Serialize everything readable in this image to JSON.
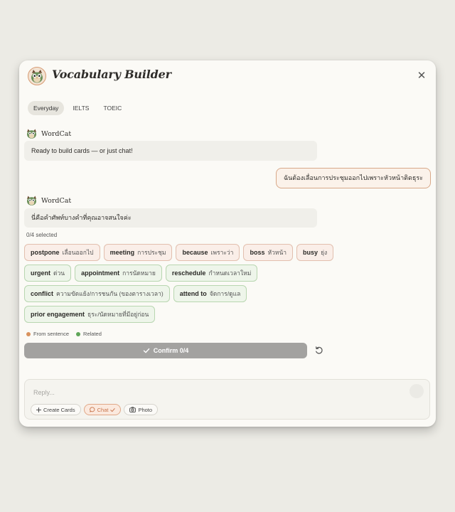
{
  "app": {
    "title": "Vocabulary Builder"
  },
  "tabs": [
    {
      "label": "Everyday",
      "active": true
    },
    {
      "label": "IELTS",
      "active": false
    },
    {
      "label": "TOEIC",
      "active": false
    }
  ],
  "messages": {
    "bot_name": "WordCat",
    "bot_first": "Ready to build cards — or just chat!",
    "user_message": "ฉันต้องเลื่อนการประชุมออกไปเพราะหัวหน้าติดธุระ",
    "bot_second": "นี่คือคำศัพท์บางคำที่คุณอาจสนใจค่ะ"
  },
  "selection": {
    "count_label": "0/4 selected"
  },
  "chips": [
    [
      {
        "word": "postpone",
        "translation": "เลื่อนออกไป",
        "kind": "sentence"
      },
      {
        "word": "meeting",
        "translation": "การประชุม",
        "kind": "sentence"
      },
      {
        "word": "because",
        "translation": "เพราะว่า",
        "kind": "sentence"
      },
      {
        "word": "boss",
        "translation": "หัวหน้า",
        "kind": "sentence"
      },
      {
        "word": "busy",
        "translation": "ยุ่ง",
        "kind": "sentence"
      }
    ],
    [
      {
        "word": "urgent",
        "translation": "ด่วน",
        "kind": "related"
      },
      {
        "word": "appointment",
        "translation": "การนัดหมาย",
        "kind": "related"
      },
      {
        "word": "reschedule",
        "translation": "กำหนดเวลาใหม่",
        "kind": "related"
      }
    ],
    [
      {
        "word": "conflict",
        "translation": "ความขัดแย้ง/การชนกัน (ของตารางเวลา)",
        "kind": "related"
      },
      {
        "word": "attend to",
        "translation": "จัดการ/ดูแล",
        "kind": "related"
      }
    ],
    [
      {
        "word": "prior engagement",
        "translation": "ธุระ/นัดหมายที่มีอยู่ก่อน",
        "kind": "related"
      }
    ]
  ],
  "legend": {
    "sentence_label": "From sentence",
    "related_label": "Related",
    "sentence_color": "#d9925e",
    "related_color": "#5fa558"
  },
  "confirm": {
    "label": "Confirm 0/4"
  },
  "composer": {
    "placeholder": "Reply...",
    "create_cards_label": "Create Cards",
    "chat_label": "Chat",
    "photo_label": "Photo"
  },
  "icons": {
    "logo": "owl-cat-logo",
    "close": "close-icon",
    "reset": "reset-icon",
    "check": "check-icon"
  }
}
